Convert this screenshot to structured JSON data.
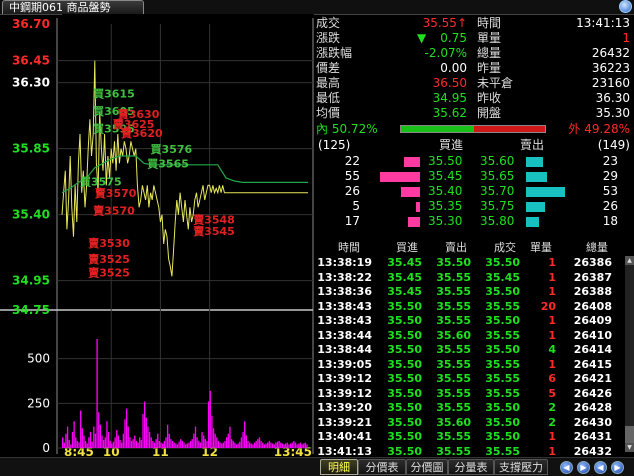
{
  "window": {
    "title": "中鋼期061 商品盤勢"
  },
  "colors": {
    "up": "#ff2a2a",
    "down": "#1fe01f",
    "flat": "#ffffff",
    "price_line": "#e8e85a",
    "avg_line": "#1fa84a",
    "volume": "#ff00ff",
    "bid_bar": "#ff3aa0",
    "ask_bar": "#18c0c0"
  },
  "chart_data": [
    {
      "type": "line",
      "y_ticks": [
        "36.70",
        "36.45",
        "36.30",
        "35.85",
        "35.40",
        "34.95",
        "34.75"
      ],
      "ylim": [
        34.75,
        36.7
      ],
      "x_ticks": [
        "8:45",
        "10",
        "11",
        "12",
        "13:45"
      ],
      "series": [
        {
          "x": [
            0,
            2,
            4,
            6,
            8,
            10,
            12,
            14,
            16,
            18,
            20,
            22,
            24,
            26,
            28,
            30,
            32,
            34,
            36,
            38,
            40,
            42,
            44,
            46,
            48,
            50,
            52,
            54,
            56,
            58,
            60,
            62,
            64,
            66,
            68,
            70,
            72,
            74,
            76,
            78,
            80,
            82,
            84,
            86,
            88,
            90,
            92,
            94,
            96,
            98,
            100,
            102,
            104,
            106,
            108,
            110,
            112,
            114,
            116,
            118,
            120,
            122,
            124,
            126,
            128,
            130,
            132,
            134,
            136,
            138,
            140,
            142,
            144,
            146,
            148,
            150,
            152,
            154,
            156,
            158,
            160,
            162,
            164,
            166,
            168,
            170,
            172,
            174,
            176,
            178,
            180,
            182,
            184,
            186,
            188,
            190,
            192,
            194,
            196,
            198,
            200,
            202,
            204,
            206,
            208,
            210,
            212,
            214,
            216,
            218,
            220,
            222,
            224,
            226,
            228,
            230,
            232,
            234,
            236,
            238,
            240,
            242,
            244,
            246,
            248,
            250,
            252,
            254,
            256,
            258,
            260,
            262,
            264,
            266,
            268,
            270,
            272,
            274,
            276,
            278,
            280,
            282,
            284,
            286,
            288,
            290,
            292,
            294,
            296,
            298,
            300
          ],
          "values": [
            35.4,
            35.55,
            35.7,
            35.3,
            35.5,
            35.8,
            35.45,
            35.25,
            35.6,
            35.35,
            35.75,
            35.95,
            35.55,
            35.7,
            35.45,
            35.6,
            35.85,
            36.05,
            35.8,
            35.95,
            36.45,
            35.75,
            35.55,
            36.1,
            35.85,
            35.7,
            35.95,
            35.6,
            35.8,
            35.65,
            35.85,
            35.75,
            35.9,
            35.7,
            35.95,
            35.75,
            35.85,
            35.8,
            35.9,
            35.85,
            35.75,
            35.8,
            35.9,
            35.85,
            35.8,
            35.85,
            35.6,
            35.45,
            35.5,
            35.6,
            35.55,
            35.5,
            35.6,
            35.45,
            35.55,
            35.5,
            35.6,
            35.55,
            35.5,
            35.45,
            35.35,
            35.4,
            35.2,
            35.3,
            35.25,
            35.1,
            35.05,
            34.98,
            35.15,
            35.35,
            35.5,
            35.4,
            35.55,
            35.45,
            35.35,
            35.5,
            35.4,
            35.3,
            35.45,
            35.35,
            35.4,
            35.5,
            35.55,
            35.45,
            35.5,
            35.55,
            35.6,
            35.5,
            35.55,
            35.6,
            35.6,
            35.55,
            35.6,
            35.55,
            35.58,
            35.55,
            35.6,
            35.55,
            35.6,
            35.55,
            35.55,
            35.55,
            35.55,
            35.55,
            35.55,
            35.55,
            35.55,
            35.55,
            35.55,
            35.55,
            35.55,
            35.55,
            35.55,
            35.55,
            35.55,
            35.55,
            35.55,
            35.55,
            35.55,
            35.55,
            35.55,
            35.55,
            35.55,
            35.55,
            35.55,
            35.55,
            35.55,
            35.55,
            35.55,
            35.55,
            35.55,
            35.55,
            35.55,
            35.55,
            35.55,
            35.55,
            35.55,
            35.55,
            35.55,
            35.55,
            35.55,
            35.55,
            35.55,
            35.55,
            35.55,
            35.55,
            35.55,
            35.55,
            35.55,
            35.55,
            35.55
          ]
        },
        {
          "x": [
            0,
            10,
            20,
            30,
            40,
            50,
            60,
            70,
            80,
            90,
            100,
            110,
            120,
            130,
            140,
            150,
            160,
            170,
            180,
            190,
            200,
            210,
            220,
            230,
            240,
            250,
            260,
            270,
            280,
            290,
            300
          ],
          "values": [
            35.55,
            35.58,
            35.62,
            35.65,
            35.72,
            35.75,
            35.78,
            35.8,
            35.8,
            35.8,
            35.75,
            35.74,
            35.74,
            35.74,
            35.74,
            35.74,
            35.74,
            35.74,
            35.74,
            35.74,
            35.65,
            35.63,
            35.62,
            35.62,
            35.62,
            35.62,
            35.62,
            35.62,
            35.62,
            35.62,
            35.62
          ]
        }
      ],
      "annotations": [
        {
          "text": "買3615",
          "side": "buy",
          "x": 38,
          "y": 36.2
        },
        {
          "text": "買3605",
          "side": "buy",
          "x": 38,
          "y": 36.08
        },
        {
          "text": "買3595",
          "side": "buy",
          "x": 38,
          "y": 35.96
        },
        {
          "text": "賣3630",
          "side": "sell",
          "x": 68,
          "y": 36.06
        },
        {
          "text": "賣3625",
          "side": "sell",
          "x": 62,
          "y": 35.99
        },
        {
          "text": "賣3620",
          "side": "sell",
          "x": 72,
          "y": 35.93
        },
        {
          "text": "買3576",
          "side": "buy",
          "x": 108,
          "y": 35.82
        },
        {
          "text": "買3565",
          "side": "buy",
          "x": 104,
          "y": 35.72
        },
        {
          "text": "買3575",
          "side": "buy",
          "x": 22,
          "y": 35.6
        },
        {
          "text": "賣3570",
          "side": "sell",
          "x": 40,
          "y": 35.52
        },
        {
          "text": "賣3570",
          "side": "sell",
          "x": 38,
          "y": 35.4
        },
        {
          "text": "賣3548",
          "side": "sell",
          "x": 160,
          "y": 35.34
        },
        {
          "text": "賣3545",
          "side": "sell",
          "x": 160,
          "y": 35.26
        },
        {
          "text": "賣3530",
          "side": "sell",
          "x": 32,
          "y": 35.18
        },
        {
          "text": "賣3525",
          "side": "sell",
          "x": 32,
          "y": 35.07
        },
        {
          "text": "賣3525",
          "side": "sell",
          "x": 32,
          "y": 34.98
        }
      ]
    },
    {
      "type": "bar",
      "y_ticks": [
        "500",
        "250",
        "0"
      ],
      "ylim": [
        0,
        750
      ],
      "values": [
        60,
        30,
        80,
        120,
        45,
        20,
        90,
        150,
        60,
        40,
        30,
        210,
        110,
        70,
        40,
        25,
        60,
        90,
        35,
        120,
        80,
        610,
        200,
        130,
        70,
        45,
        60,
        150,
        90,
        40,
        25,
        35,
        60,
        100,
        70,
        45,
        30,
        80,
        160,
        220,
        120,
        60,
        40,
        50,
        70,
        40,
        30,
        60,
        45,
        190,
        260,
        170,
        120,
        90,
        60,
        40,
        30,
        50,
        80,
        40,
        30,
        25,
        40,
        60,
        130,
        80,
        50,
        40,
        30,
        25,
        20,
        35,
        50,
        40,
        30,
        20,
        25,
        30,
        40,
        50,
        80,
        120,
        60,
        40,
        30,
        90,
        70,
        50,
        40,
        260,
        320,
        180,
        110,
        80,
        60,
        40,
        30,
        25,
        30,
        40,
        60,
        80,
        120,
        50,
        40,
        30,
        20,
        25,
        35,
        60,
        90,
        150,
        70,
        40,
        30,
        25,
        20,
        30,
        40,
        50,
        60,
        40,
        30,
        20,
        25,
        30,
        40,
        30,
        25,
        20,
        30,
        35,
        40,
        30,
        25,
        20,
        25,
        30,
        20,
        25,
        30,
        40,
        30,
        20,
        25,
        30,
        20,
        25,
        30,
        20
      ]
    }
  ],
  "quote": {
    "left": [
      {
        "label": "成交",
        "value": "35.55",
        "suffix": "↑",
        "color": "up"
      },
      {
        "label": "漲跌",
        "value": "0.75",
        "prefix": "▼",
        "color": "down"
      },
      {
        "label": "漲跌幅",
        "value": "-2.07%",
        "color": "down"
      },
      {
        "label": "價差",
        "value": "0.00",
        "color": "flat"
      },
      {
        "label": "最高",
        "value": "36.50",
        "color": "up"
      },
      {
        "label": "最低",
        "value": "34.95",
        "color": "down"
      },
      {
        "label": "均價",
        "value": "35.62",
        "color": "down"
      }
    ],
    "right": [
      {
        "label": "時間",
        "value": "13:41:13"
      },
      {
        "label": "單量",
        "value": "1",
        "color": "up"
      },
      {
        "label": "總量",
        "value": "26432"
      },
      {
        "label": "昨量",
        "value": "36223"
      },
      {
        "label": "未平倉",
        "value": "23160"
      },
      {
        "label": "昨收",
        "value": "36.30"
      },
      {
        "label": "開盤",
        "value": "35.30"
      }
    ]
  },
  "ratio": {
    "in_label": "內",
    "in_pct": "50.72%",
    "out_label": "外",
    "out_pct": "49.28%",
    "in_fraction": 0.5072
  },
  "depth": {
    "bid_total": "(125)",
    "ask_total": "(149)",
    "bid_header": "買進",
    "ask_header": "賣出",
    "rows": [
      {
        "bid_qty": "22",
        "bid": "35.50",
        "ask": "35.60",
        "ask_qty": "23",
        "bid_n": 22,
        "ask_n": 23
      },
      {
        "bid_qty": "55",
        "bid": "35.45",
        "ask": "35.65",
        "ask_qty": "29",
        "bid_n": 55,
        "ask_n": 29
      },
      {
        "bid_qty": "26",
        "bid": "35.40",
        "ask": "35.70",
        "ask_qty": "53",
        "bid_n": 26,
        "ask_n": 53
      },
      {
        "bid_qty": "5",
        "bid": "35.35",
        "ask": "35.75",
        "ask_qty": "26",
        "bid_n": 5,
        "ask_n": 26
      },
      {
        "bid_qty": "17",
        "bid": "35.30",
        "ask": "35.80",
        "ask_qty": "18",
        "bid_n": 17,
        "ask_n": 18
      }
    ]
  },
  "ticks": {
    "headers": [
      "時間",
      "買進",
      "賣出",
      "成交",
      "單量",
      "總量"
    ],
    "rows": [
      [
        "13:38:19",
        "35.45",
        "35.50",
        "35.50",
        "1",
        "26386"
      ],
      [
        "13:38:22",
        "35.45",
        "35.55",
        "35.45",
        "1",
        "26387"
      ],
      [
        "13:38:36",
        "35.45",
        "35.55",
        "35.50",
        "1",
        "26388"
      ],
      [
        "13:38:43",
        "35.50",
        "35.55",
        "35.55",
        "20",
        "26408"
      ],
      [
        "13:38:43",
        "35.50",
        "35.55",
        "35.50",
        "1",
        "26409"
      ],
      [
        "13:38:44",
        "35.50",
        "35.60",
        "35.55",
        "1",
        "26410"
      ],
      [
        "13:38:44",
        "35.50",
        "35.55",
        "35.50",
        "4",
        "26414"
      ],
      [
        "13:39:05",
        "35.50",
        "35.55",
        "35.55",
        "1",
        "26415"
      ],
      [
        "13:39:12",
        "35.50",
        "35.55",
        "35.55",
        "6",
        "26421"
      ],
      [
        "13:39:12",
        "35.50",
        "35.55",
        "35.55",
        "5",
        "26426"
      ],
      [
        "13:39:20",
        "35.50",
        "35.55",
        "35.50",
        "2",
        "26428"
      ],
      [
        "13:39:21",
        "35.50",
        "35.60",
        "35.50",
        "2",
        "26430"
      ],
      [
        "13:40:41",
        "35.50",
        "35.55",
        "35.50",
        "1",
        "26431"
      ],
      [
        "13:41:13",
        "35.50",
        "35.55",
        "35.55",
        "1",
        "26432"
      ]
    ],
    "row_colors": [
      [
        "down",
        "down",
        "down",
        "up",
        "down"
      ],
      [
        "down",
        "down",
        "down",
        "up",
        "down"
      ],
      [
        "down",
        "down",
        "down",
        "up",
        "down"
      ],
      [
        "down",
        "down",
        "down",
        "up",
        "up"
      ],
      [
        "down",
        "down",
        "down",
        "up",
        "down"
      ],
      [
        "down",
        "down",
        "down",
        "up",
        "down"
      ],
      [
        "down",
        "down",
        "down",
        "down",
        "down"
      ],
      [
        "down",
        "down",
        "down",
        "up",
        "down"
      ],
      [
        "down",
        "down",
        "down",
        "up",
        "up"
      ],
      [
        "down",
        "down",
        "down",
        "up",
        "up"
      ],
      [
        "down",
        "down",
        "down",
        "down",
        "down"
      ],
      [
        "down",
        "down",
        "down",
        "down",
        "down"
      ],
      [
        "down",
        "down",
        "down",
        "up",
        "down"
      ],
      [
        "down",
        "down",
        "down",
        "up",
        "down"
      ]
    ]
  },
  "tabs": [
    {
      "label": "明細",
      "active": true
    },
    {
      "label": "分價表",
      "active": false
    },
    {
      "label": "分價圖",
      "active": false
    },
    {
      "label": "分量表",
      "active": false
    },
    {
      "label": "支撐壓力",
      "active": false
    }
  ],
  "icons": [
    "zoom-icon",
    "prev-icon",
    "next-icon",
    "first-icon",
    "last-icon"
  ]
}
